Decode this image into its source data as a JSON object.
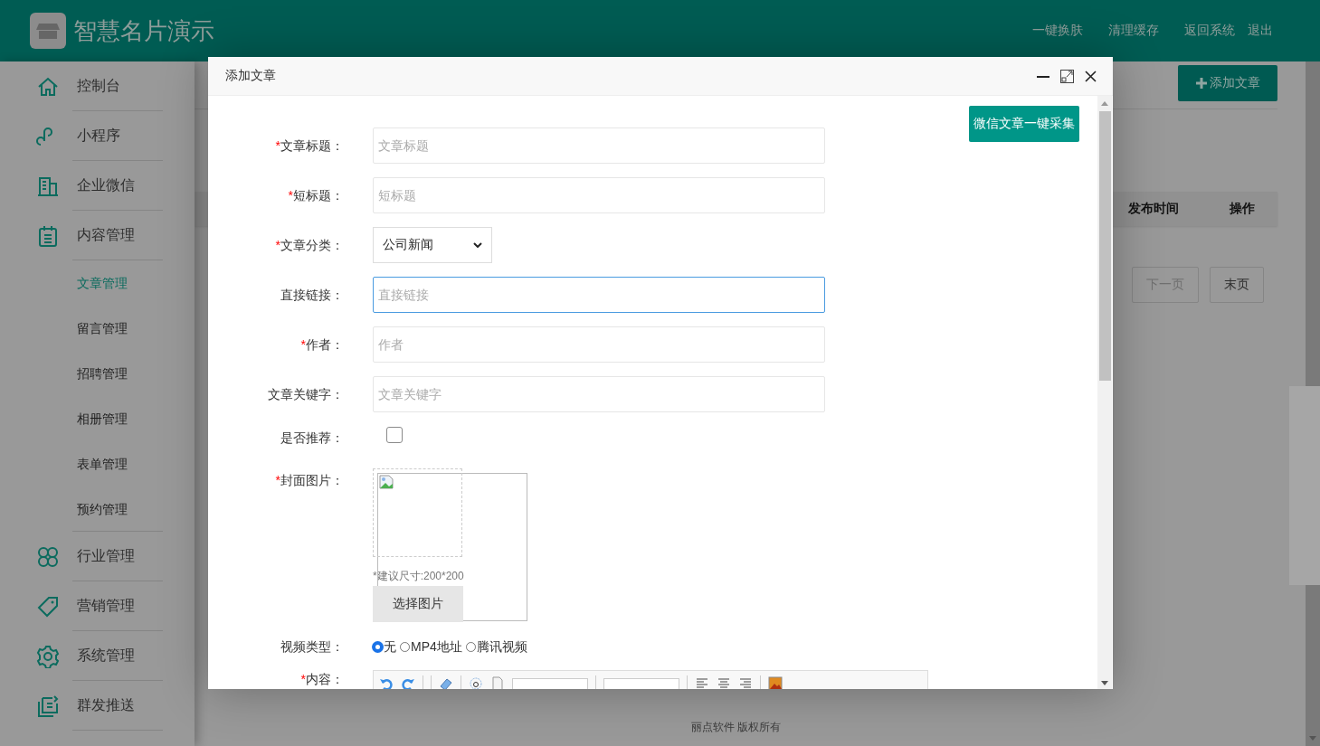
{
  "header": {
    "title": "智慧名片演示",
    "links": [
      "一键换肤",
      "清理缓存",
      "返回系统",
      "退出"
    ]
  },
  "sidebar": {
    "items": [
      {
        "label": "控制台"
      },
      {
        "label": "小程序"
      },
      {
        "label": "企业微信"
      },
      {
        "label": "内容管理",
        "children": [
          {
            "label": "文章管理",
            "selected": true
          },
          {
            "label": "留言管理",
            "selected": false
          },
          {
            "label": "招聘管理",
            "selected": false
          },
          {
            "label": "相册管理",
            "selected": false
          },
          {
            "label": "表单管理",
            "selected": false
          },
          {
            "label": "预约管理",
            "selected": false
          }
        ]
      },
      {
        "label": "行业管理"
      },
      {
        "label": "营销管理"
      },
      {
        "label": "系统管理"
      },
      {
        "label": "群发推送"
      }
    ]
  },
  "main": {
    "add_button": "添加文章",
    "table": {
      "columns": [
        "发布时间",
        "操作"
      ]
    },
    "pagination": [
      {
        "label": "下一页",
        "disabled": true
      },
      {
        "label": "末页",
        "disabled": false
      }
    ],
    "footer": "丽点软件 版权所有"
  },
  "dialog": {
    "title": "添加文章",
    "collect_button": "微信文章一键采集",
    "fields": [
      {
        "kind": "text",
        "required_mark": "*",
        "label": "文章标题：",
        "placeholder": "文章标题",
        "focused": false
      },
      {
        "kind": "text",
        "required_mark": "*",
        "label": "短标题：",
        "placeholder": "短标题",
        "focused": false
      },
      {
        "kind": "select",
        "required_mark": "*",
        "label": "文章分类：",
        "value": "公司新闻"
      },
      {
        "kind": "text",
        "label": "直接链接：",
        "placeholder": "直接链接",
        "focused": true
      },
      {
        "kind": "text",
        "required_mark": "*",
        "label": "作者：",
        "placeholder": "作者",
        "focused": false
      },
      {
        "kind": "text",
        "label": "文章关键字：",
        "placeholder": "文章关键字",
        "focused": false
      },
      {
        "kind": "checkbox",
        "label": "是否推荐：",
        "checked": false
      },
      {
        "kind": "image",
        "required_mark": "*",
        "label": "封面图片：",
        "hint": "*建议尺寸:200*200",
        "button": "选择图片"
      },
      {
        "kind": "radio",
        "label": "视频类型：",
        "options": [
          {
            "label": "无",
            "selected": true
          },
          {
            "label": "MP4地址",
            "selected": false
          },
          {
            "label": "腾讯视频",
            "selected": false
          }
        ]
      },
      {
        "kind": "editor",
        "required_mark": "*",
        "label": "内容：",
        "toolbar": [
          {
            "kind": "undo"
          },
          {
            "kind": "redo"
          },
          {
            "kind": "sep"
          },
          {
            "kind": "sep"
          },
          {
            "kind": "eraser"
          },
          {
            "kind": "sep"
          },
          {
            "kind": "anchor"
          },
          {
            "kind": "page"
          },
          {
            "kind": "dropdown"
          },
          {
            "kind": "sep"
          },
          {
            "kind": "dropdown"
          },
          {
            "kind": "sep"
          },
          {
            "kind": "align-left"
          },
          {
            "kind": "align-center"
          },
          {
            "kind": "align-right"
          },
          {
            "kind": "sep"
          },
          {
            "kind": "image"
          }
        ]
      }
    ]
  }
}
